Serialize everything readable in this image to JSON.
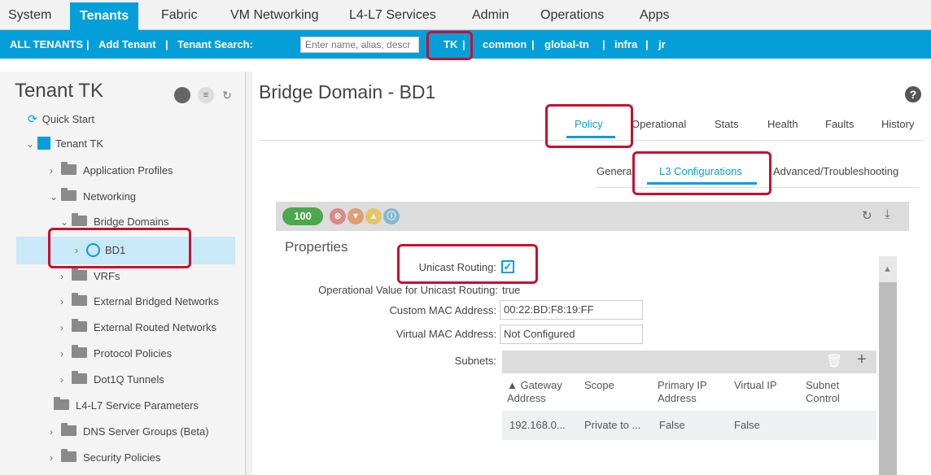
{
  "topnav": {
    "items": [
      "System",
      "Tenants",
      "Fabric",
      "VM Networking",
      "L4-L7 Services",
      "Admin",
      "Operations",
      "Apps"
    ]
  },
  "tenantbar": {
    "all_tenants": "ALL TENANTS",
    "sep": "|",
    "add_tenant": "Add Tenant",
    "search_label": "Tenant Search:",
    "search_placeholder": "Enter name, alias, descr",
    "tenants": [
      "TK",
      "common",
      "global-tn",
      "infra",
      "jr"
    ]
  },
  "left": {
    "title": "Tenant TK",
    "quick_start": "Quick Start",
    "tenant_node": "Tenant TK",
    "tree": {
      "application_profiles": "Application Profiles",
      "networking": "Networking",
      "bridge_domains": "Bridge Domains",
      "bd1": "BD1",
      "vrfs": "VRFs",
      "external_bridged": "External Bridged Networks",
      "external_routed": "External Routed Networks",
      "protocol_policies": "Protocol Policies",
      "dot1q": "Dot1Q Tunnels",
      "l4l7_params": "L4-L7 Service Parameters",
      "dns": "DNS Server Groups (Beta)",
      "security": "Security Policies"
    }
  },
  "main": {
    "title": "Bridge Domain - BD1",
    "help": "?",
    "tabs": [
      "Policy",
      "Operational",
      "Stats",
      "Health",
      "Faults",
      "History"
    ],
    "subtabs": [
      "General",
      "L3 Configurations",
      "Advanced/Troubleshooting"
    ],
    "health_score": "100",
    "properties_label": "Properties",
    "fields": {
      "unicast_routing_label": "Unicast Routing:",
      "unicast_routing_checked": "✓",
      "operational_label": "Operational Value for Unicast Routing:",
      "operational_value": "true",
      "custom_mac_label": "Custom MAC Address:",
      "custom_mac_value": "00:22:BD:F8:19:FF",
      "virtual_mac_label": "Virtual MAC Address:",
      "virtual_mac_value": "Not Configured",
      "subnets_label": "Subnets:"
    },
    "subnets_table": {
      "headers": {
        "gateway": [
          "▲ Gateway",
          "Address"
        ],
        "scope": "Scope",
        "primary": [
          "Primary IP",
          "Address"
        ],
        "virtual": "Virtual IP",
        "control": [
          "Subnet",
          "Control"
        ]
      },
      "rows": [
        {
          "gateway": "192.168.0...",
          "scope": "Private to ...",
          "primary": "False",
          "virtual": "False"
        }
      ]
    }
  }
}
